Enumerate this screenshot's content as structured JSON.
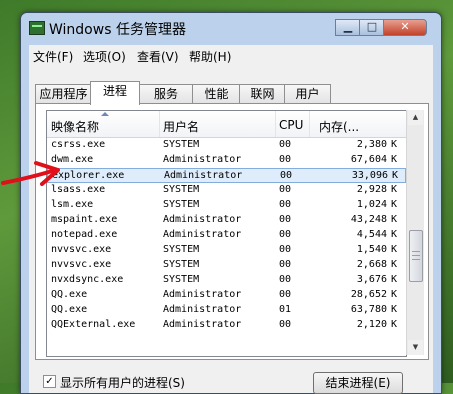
{
  "window": {
    "title": "Windows 任务管理器",
    "min_label": "▁",
    "max_label": "□",
    "close_label": "✕"
  },
  "menu": [
    "文件(F)",
    "选项(O)",
    "查看(V)",
    "帮助(H)"
  ],
  "tabs": [
    {
      "label": "应用程序",
      "active": false
    },
    {
      "label": "进程",
      "active": true
    },
    {
      "label": "服务",
      "active": false
    },
    {
      "label": "性能",
      "active": false
    },
    {
      "label": "联网",
      "active": false
    },
    {
      "label": "用户",
      "active": false
    }
  ],
  "columns": {
    "name": "映像名称",
    "user": "用户名",
    "cpu": "CPU",
    "mem": "内存(..."
  },
  "processes": [
    {
      "name": "csrss.exe",
      "user": "SYSTEM",
      "cpu": "00",
      "mem": "2,380",
      "unit": "K"
    },
    {
      "name": "dwm.exe",
      "user": "Administrator",
      "cpu": "00",
      "mem": "67,604",
      "unit": "K"
    },
    {
      "name": "explorer.exe",
      "user": "Administrator",
      "cpu": "00",
      "mem": "33,096",
      "unit": "K",
      "selected": true
    },
    {
      "name": "lsass.exe",
      "user": "SYSTEM",
      "cpu": "00",
      "mem": "2,928",
      "unit": "K"
    },
    {
      "name": "lsm.exe",
      "user": "SYSTEM",
      "cpu": "00",
      "mem": "1,024",
      "unit": "K"
    },
    {
      "name": "mspaint.exe",
      "user": "Administrator",
      "cpu": "00",
      "mem": "43,248",
      "unit": "K"
    },
    {
      "name": "notepad.exe",
      "user": "Administrator",
      "cpu": "00",
      "mem": "4,544",
      "unit": "K"
    },
    {
      "name": "nvvsvc.exe",
      "user": "SYSTEM",
      "cpu": "00",
      "mem": "1,540",
      "unit": "K"
    },
    {
      "name": "nvvsvc.exe",
      "user": "SYSTEM",
      "cpu": "00",
      "mem": "2,668",
      "unit": "K"
    },
    {
      "name": "nvxdsync.exe",
      "user": "SYSTEM",
      "cpu": "00",
      "mem": "3,676",
      "unit": "K"
    },
    {
      "name": "QQ.exe",
      "user": "Administrator",
      "cpu": "00",
      "mem": "28,652",
      "unit": "K"
    },
    {
      "name": "QQ.exe",
      "user": "Administrator",
      "cpu": "01",
      "mem": "63,780",
      "unit": "K"
    },
    {
      "name": "QQExternal.exe",
      "user": "Administrator",
      "cpu": "00",
      "mem": "2,120",
      "unit": "K"
    }
  ],
  "footer": {
    "show_all_label": "显示所有用户的进程(S)",
    "show_all_checked": true,
    "end_process_label": "结束进程(E)"
  },
  "colors": {
    "selection": "#dfecfb",
    "annotation_arrow": "#e0101a"
  }
}
